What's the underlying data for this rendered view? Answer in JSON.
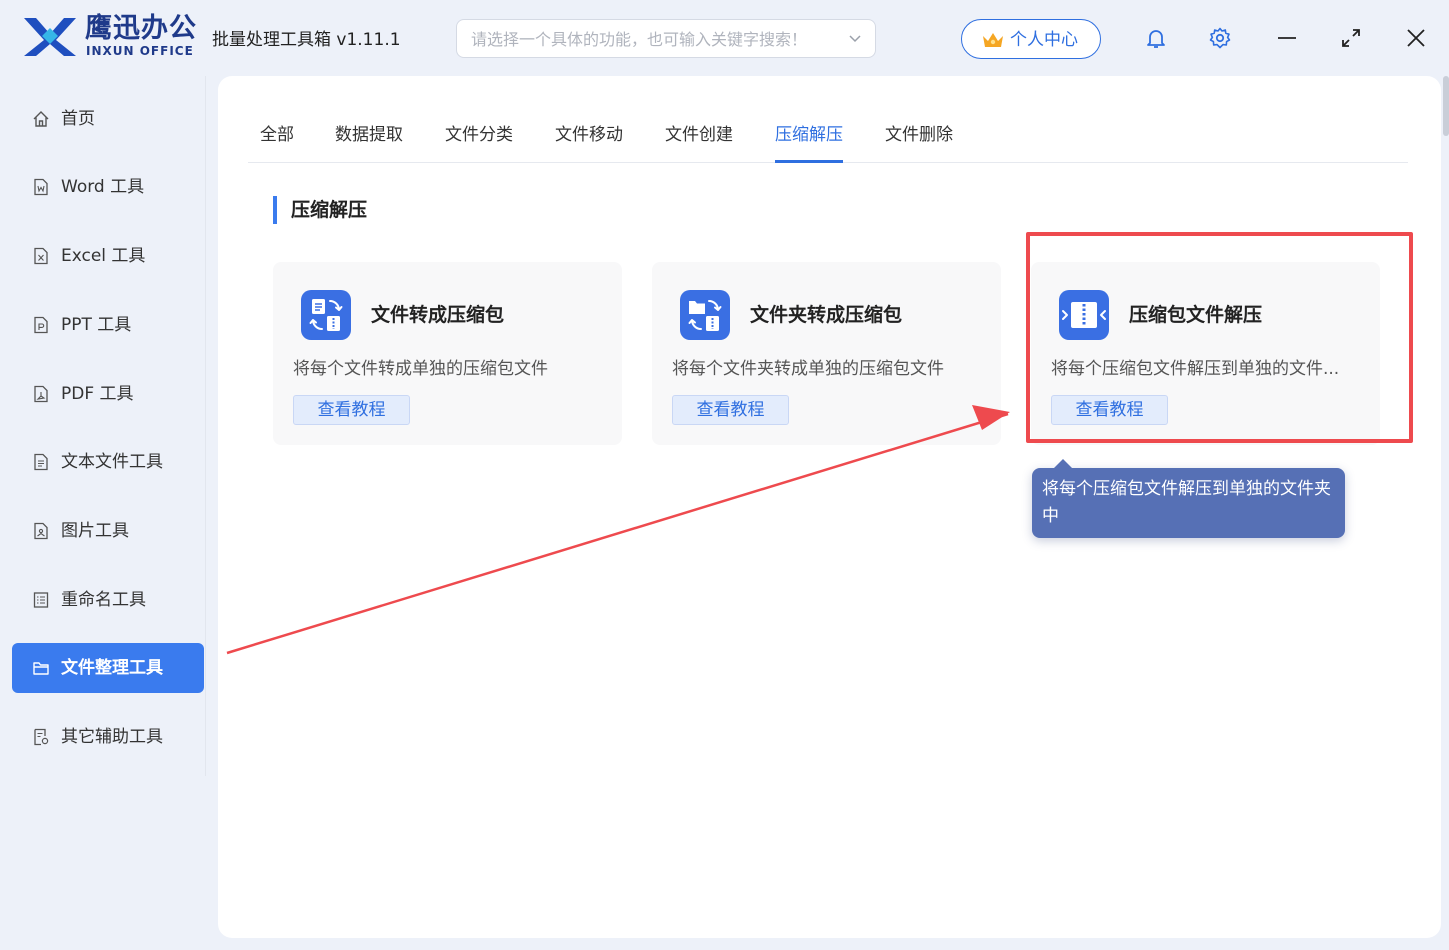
{
  "app": {
    "brand_cn": "鹰迅办公",
    "brand_en": "INXUN OFFICE",
    "title": "批量处理工具箱 v1.11.1",
    "search_placeholder": "请选择一个具体的功能，也可输入关键字搜索！",
    "user_center": "个人中心",
    "accent": "#3a7bee",
    "annotation_color": "#ee4a4e"
  },
  "sidebar": {
    "items": [
      {
        "label": "首页",
        "icon": "home-icon"
      },
      {
        "label": "Word 工具",
        "icon": "word-doc-icon"
      },
      {
        "label": "Excel 工具",
        "icon": "excel-doc-icon"
      },
      {
        "label": "PPT 工具",
        "icon": "ppt-doc-icon"
      },
      {
        "label": "PDF 工具",
        "icon": "pdf-doc-icon"
      },
      {
        "label": "文本文件工具",
        "icon": "text-file-icon"
      },
      {
        "label": "图片工具",
        "icon": "image-file-icon"
      },
      {
        "label": "重命名工具",
        "icon": "rename-icon"
      },
      {
        "label": "文件整理工具",
        "icon": "folder-icon",
        "active": true
      },
      {
        "label": "其它辅助工具",
        "icon": "tools-icon"
      }
    ]
  },
  "main": {
    "tabs": [
      "全部",
      "数据提取",
      "文件分类",
      "文件移动",
      "文件创建",
      "压缩解压",
      "文件删除"
    ],
    "active_tab": "压缩解压",
    "section_title": "压缩解压",
    "cards": [
      {
        "title": "文件转成压缩包",
        "desc": "将每个文件转成单独的压缩包文件",
        "button": "查看教程",
        "icon": "file-to-archive-icon"
      },
      {
        "title": "文件夹转成压缩包",
        "desc": "将每个文件夹转成单独的压缩包文件",
        "button": "查看教程",
        "icon": "folder-to-archive-icon"
      },
      {
        "title": "压缩包文件解压",
        "desc": "将每个压缩包文件解压到单独的文件...",
        "button": "查看教程",
        "icon": "archive-extract-icon"
      }
    ],
    "tooltip": "将每个压缩包文件解压到单独的文件夹中"
  }
}
